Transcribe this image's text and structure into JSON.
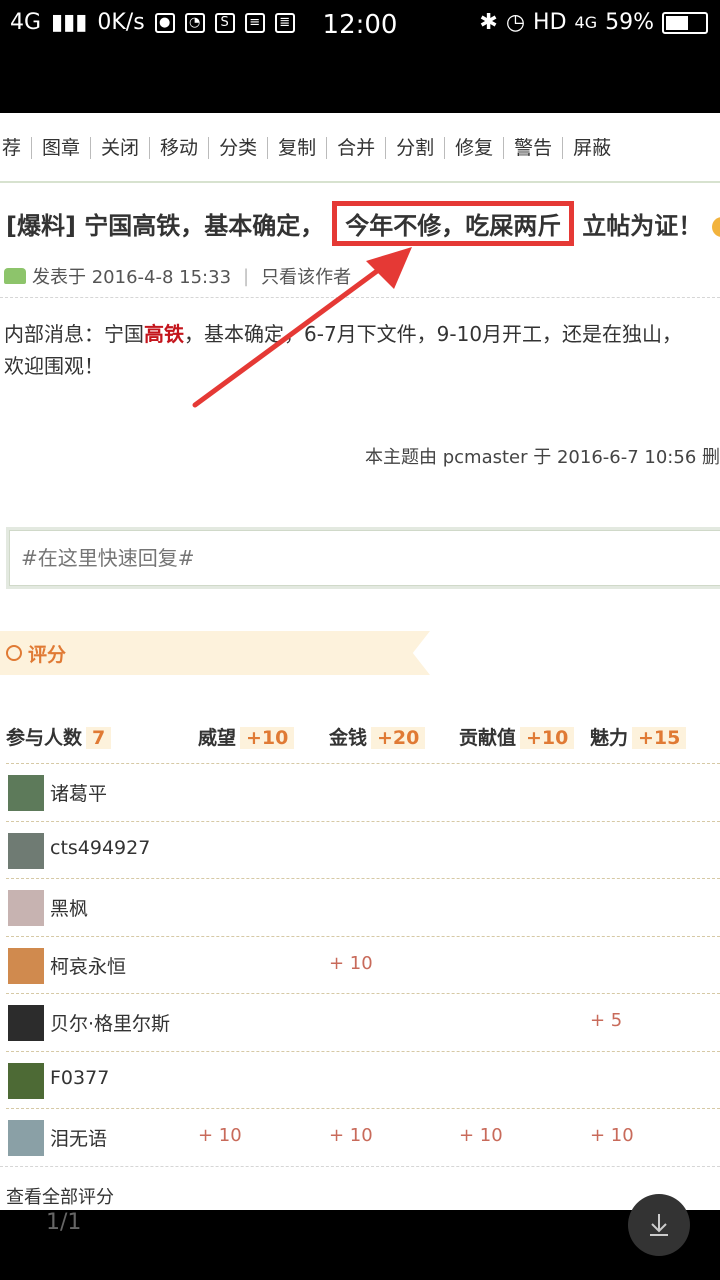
{
  "statusbar": {
    "network": "4G",
    "speed": "0K/s",
    "time": "12:00",
    "hd": "HD",
    "net_type": "4G",
    "battery": "59%",
    "battery_level": 0.59
  },
  "toolbar": {
    "items": [
      "荐",
      "图章",
      "关闭",
      "移动",
      "分类",
      "复制",
      "合并",
      "分割",
      "修复",
      "警告",
      "屏蔽"
    ]
  },
  "post": {
    "title_prefix": "[爆料] 宁国高铁，基本确定，",
    "title_highlight": "今年不修，吃屎两斤",
    "title_suffix": "立帖为证！",
    "posted_at": "发表于 2016-4-8 15:33",
    "author_only": "只看该作者",
    "content_part1": "内部消息：宁国",
    "content_red": "高铁",
    "content_part2": "，基本确定，6-7月下文件，9-10月开工，还是在独山，",
    "content_line2": "欢迎围观！",
    "edited_note": "本主题由 pcmaster 于 2016-6-7 10:56 删"
  },
  "reply": {
    "placeholder": "#在这里快速回复#"
  },
  "rating": {
    "tab_label": "评分",
    "participants_label": "参与人数",
    "participants_count": "7",
    "columns": [
      {
        "label": "威望",
        "total": "+10"
      },
      {
        "label": "金钱",
        "total": "+20"
      },
      {
        "label": "贡献值",
        "total": "+10"
      },
      {
        "label": "魅力",
        "total": "+15"
      }
    ],
    "rows": [
      {
        "name": "诸葛平",
        "values": [
          "",
          "",
          "",
          ""
        ],
        "avatar_color": "#5d7a5a"
      },
      {
        "name": "cts494927",
        "values": [
          "",
          "",
          "",
          ""
        ],
        "avatar_color": "#6f7b73"
      },
      {
        "name": "黑枫",
        "values": [
          "",
          "",
          "",
          ""
        ],
        "avatar_color": "#c7b3b1"
      },
      {
        "name": "柯哀永恒",
        "values": [
          "",
          "+ 10",
          "",
          ""
        ],
        "avatar_color": "#d08a4e"
      },
      {
        "name": "贝尔·格里尔斯",
        "values": [
          "",
          "",
          "",
          "+ 5"
        ],
        "avatar_color": "#2c2c2c"
      },
      {
        "name": "F0377",
        "values": [
          "",
          "",
          "",
          ""
        ],
        "avatar_color": "#4d6a35"
      },
      {
        "name": "泪无语",
        "values": [
          "+ 10",
          "+ 10",
          "+ 10",
          "+ 10"
        ],
        "avatar_color": "#8aa0a6"
      }
    ],
    "view_all": "查看全部评分"
  },
  "viewer": {
    "pager": "1/1"
  }
}
